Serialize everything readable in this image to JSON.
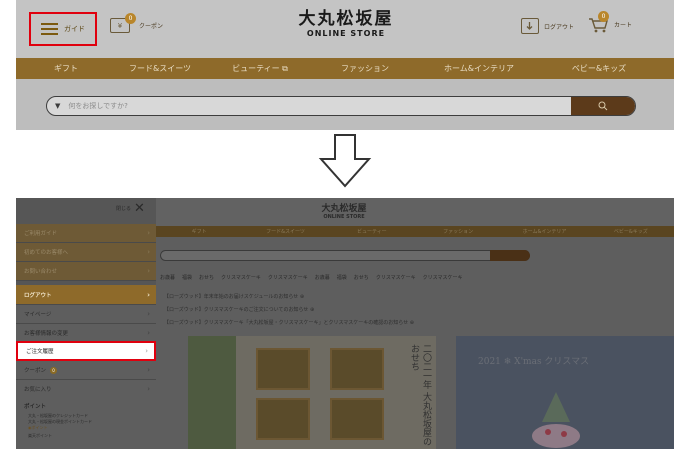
{
  "top": {
    "header": {
      "guide_label": "ガイド",
      "coupon_label": "クーポン",
      "coupon_badge": "0",
      "coupon_icon_text": "¥",
      "logo_main": "大丸松坂屋",
      "logo_sub": "ONLINE STORE",
      "logout_label": "ログアウト",
      "cart_label": "カート",
      "cart_badge": "0"
    },
    "nav": [
      "ギフト",
      "フード&スイーツ",
      "ビューティー ⧉",
      "ファッション",
      "ホーム&インテリア",
      "ベビー&キッズ"
    ],
    "search": {
      "placeholder": "何をお探しですか?"
    }
  },
  "bottom": {
    "menu": {
      "close_label": "閉じる",
      "rows_top": [
        "ご利用ガイド",
        "初めてのお客様へ",
        "お問い合わせ"
      ],
      "logout": "ログアウト",
      "rows_account": [
        "マイページ",
        "お客様情報の変更",
        "ご注文履歴"
      ],
      "coupon": "クーポン",
      "coupon_badge": "0",
      "favorites": "お気に入り",
      "points_title": "ポイント",
      "points_items": [
        "大丸・松坂屋のクレジットカード",
        "大丸・松坂屋の現金ポイントカード"
      ],
      "points_sub": "◉ポイント",
      "points_last": "楽天ポイント"
    },
    "background": {
      "logo_main": "大丸松坂屋",
      "logo_sub": "ONLINE STORE",
      "nav": [
        "ギフト",
        "フード&スイーツ",
        "ビューティー",
        "ファッション",
        "ホーム&インテリア",
        "ベビー&キッズ"
      ],
      "tags": [
        "お歳暮",
        "福袋",
        "おせち",
        "クリスマスケーキ",
        "クリスマスケーキ",
        "お歳暮",
        "福袋",
        "おせち",
        "クリスマスケーキ",
        "クリスマスケーキ"
      ],
      "notices": [
        "【ローズウッド】年末年始のお届けスケジュールのお知らせ ⊕",
        "【ローズウッド】クリスマスケーキのご注文についてのお知らせ ⊕",
        "【ローズウッド】クリスマスケーキ「大丸松坂屋・クリスマスケーキ」とクリスマスケーキの確認のお知らせ ⊕"
      ],
      "banner_text": "二〇二一年 大丸松坂屋の おせち",
      "christmas_text": "2021 ❄ X'mas クリスマス"
    }
  }
}
